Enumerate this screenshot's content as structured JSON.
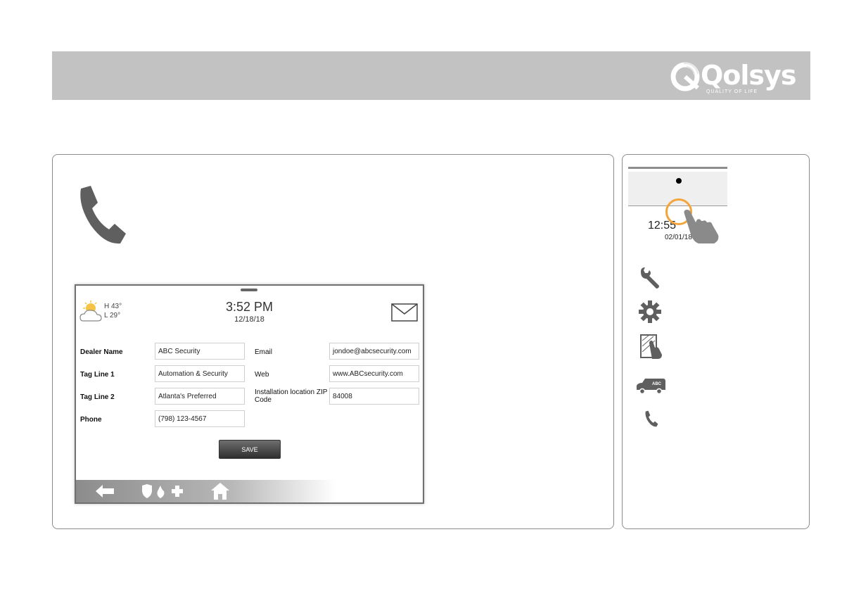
{
  "brand": {
    "logo_text": "Qolsys",
    "tagline": "QUALITY OF LIFE"
  },
  "device": {
    "weather": {
      "high": "H 43°",
      "low": "L 29°"
    },
    "time": "3:52 PM",
    "date": "12/18/18",
    "form": {
      "dealer_name": {
        "label": "Dealer Name",
        "value": "ABC Security"
      },
      "tag_line_1": {
        "label": "Tag Line 1",
        "value": "Automation & Security"
      },
      "tag_line_2": {
        "label": "Tag Line 2",
        "value": "Atlanta's Preferred"
      },
      "phone": {
        "label": "Phone",
        "value": "(798) 123-4567"
      },
      "email": {
        "label": "Email",
        "value": "jondoe@abcsecurity.com"
      },
      "web": {
        "label": "Web",
        "value": "www.ABCsecurity.com"
      },
      "zip": {
        "label": "Installation location ZIP Code",
        "value": "84008"
      }
    },
    "save_label": "SAVE"
  },
  "side": {
    "time": "12:55",
    "date": "02/01/18",
    "van_badge": "ABC"
  },
  "colors": {
    "header": "#c2c2c2",
    "accent_ring": "#f3a43a",
    "icon_gray": "#5f5f5f"
  }
}
